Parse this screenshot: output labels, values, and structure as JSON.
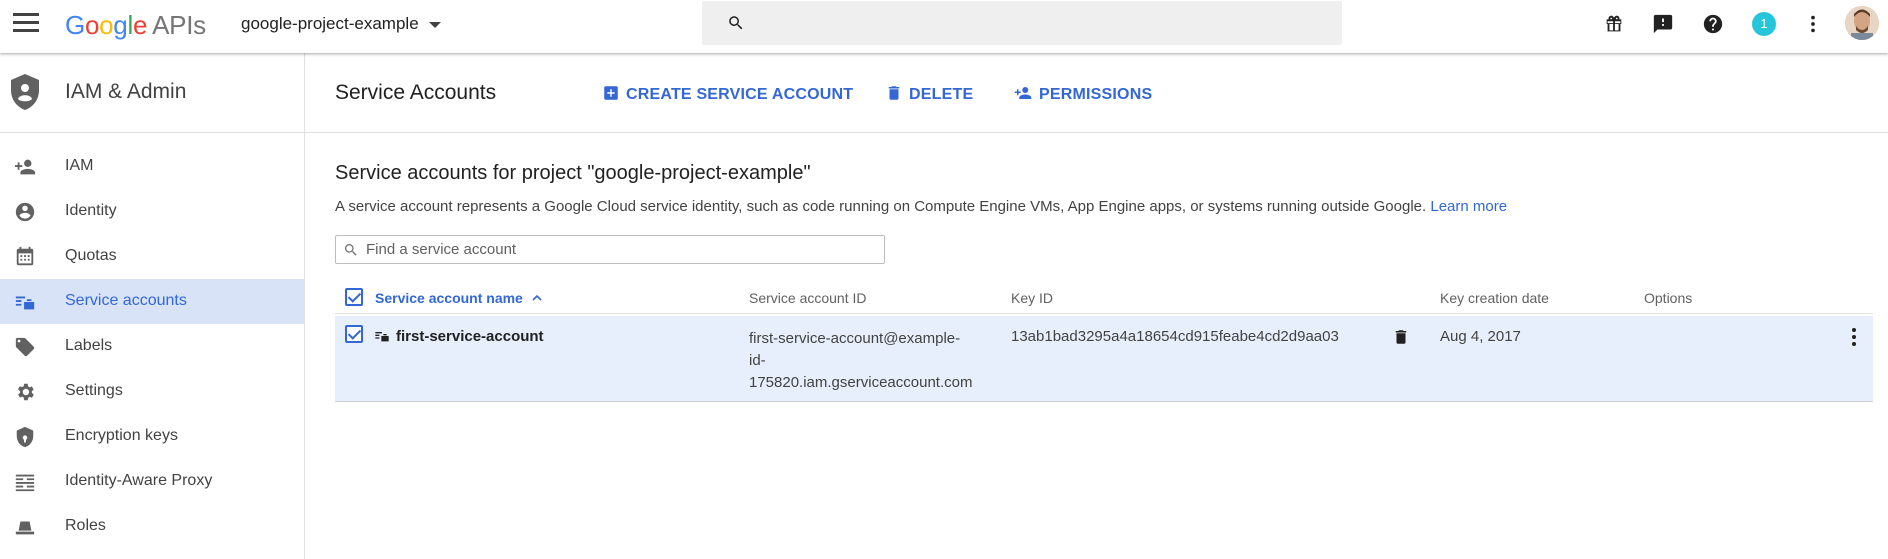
{
  "topbar": {
    "logo_letters": [
      "G",
      "o",
      "o",
      "g",
      "l",
      "e"
    ],
    "logo_suffix": "APIs",
    "project_name": "google-project-example",
    "notification_count": "1",
    "icons": [
      "menu-icon",
      "gift-icon",
      "alert-icon",
      "help-icon",
      "more-vert-icon",
      "search-icon"
    ]
  },
  "sidebar": {
    "title": "IAM & Admin",
    "items": [
      {
        "label": "IAM",
        "icon": "person-add-icon"
      },
      {
        "label": "Identity",
        "icon": "account-circle-icon"
      },
      {
        "label": "Quotas",
        "icon": "calendar-icon"
      },
      {
        "label": "Service accounts",
        "icon": "service-account-icon",
        "active": true
      },
      {
        "label": "Labels",
        "icon": "label-icon"
      },
      {
        "label": "Settings",
        "icon": "gear-icon"
      },
      {
        "label": "Encryption keys",
        "icon": "shield-key-icon"
      },
      {
        "label": "Identity-Aware Proxy",
        "icon": "proxy-icon"
      },
      {
        "label": "Roles",
        "icon": "hat-icon"
      }
    ]
  },
  "header": {
    "title": "Service Accounts",
    "actions": {
      "create": "CREATE SERVICE ACCOUNT",
      "delete": "DELETE",
      "permissions": "PERMISSIONS"
    }
  },
  "content": {
    "section_title": "Service accounts for project \"google-project-example\"",
    "description": "A service account represents a Google Cloud service identity, such as code running on Compute Engine VMs, App Engine apps, or systems running outside Google.",
    "learn_more": "Learn more",
    "filter_placeholder": "Find a service account"
  },
  "table": {
    "columns": {
      "name": "Service account name",
      "id": "Service account ID",
      "key_id": "Key ID",
      "key_date": "Key creation date",
      "options": "Options"
    },
    "rows": [
      {
        "name": "first-service-account",
        "id_line1": "first-service-account@example-",
        "id_line2": "id-",
        "id_line3": "175820.iam.gserviceaccount.com",
        "key_id": "13ab1bad3295a4a18654cd915feabe4cd2d9aa03",
        "key_date": "Aug 4, 2017",
        "checked": true
      }
    ]
  },
  "colors": {
    "accent": "#3367d6",
    "active_bg": "#d8e3f8",
    "row_bg": "#e8effc"
  }
}
